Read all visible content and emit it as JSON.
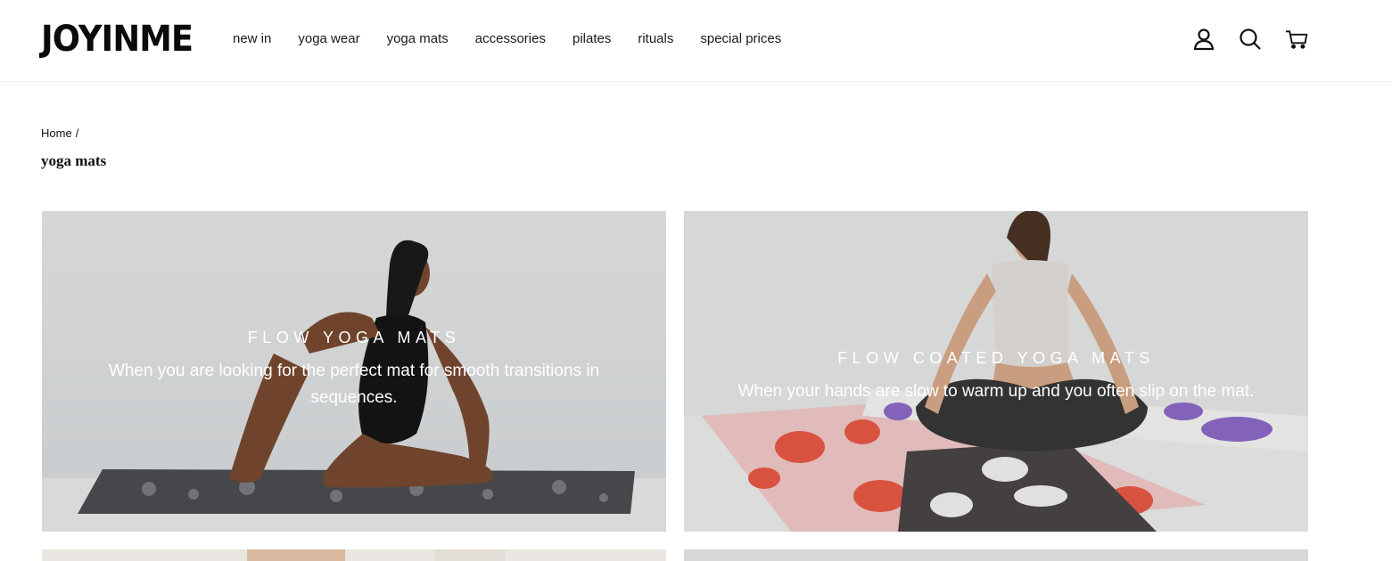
{
  "header": {
    "logo": "JOYINME",
    "nav": [
      {
        "label": "new in"
      },
      {
        "label": "yoga wear"
      },
      {
        "label": "yoga mats"
      },
      {
        "label": "accessories"
      },
      {
        "label": "pilates"
      },
      {
        "label": "rituals"
      },
      {
        "label": "special prices"
      }
    ],
    "icons": [
      "account-icon",
      "search-icon",
      "cart-icon"
    ]
  },
  "breadcrumb": {
    "home": "Home",
    "separator": "/"
  },
  "page_title": "yoga mats",
  "collections": [
    {
      "title": "FLOW YOGA MATS",
      "subtitle": "When you are looking for the perfect mat for smooth transitions in sequences."
    },
    {
      "title": "FLOW COATED YOGA MATS",
      "subtitle": "When your hands are slow to warm up and you often slip on the mat."
    }
  ],
  "colors": {
    "text": "#111111",
    "overlay_text": "#ffffff",
    "border": "#eeeeee"
  }
}
